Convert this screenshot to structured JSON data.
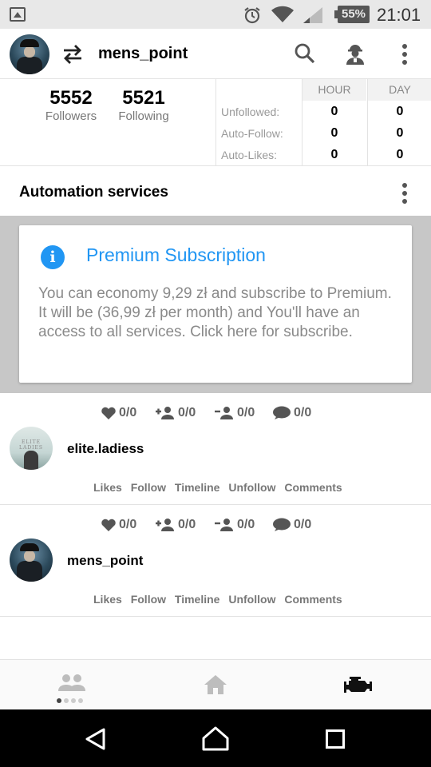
{
  "status_bar": {
    "battery": "55%",
    "time": "21:01"
  },
  "app_bar": {
    "username": "mens_point",
    "icons": [
      "swap-icon",
      "search-icon",
      "worker-icon",
      "more-vert-icon"
    ]
  },
  "stats": {
    "followers_count": "5552",
    "followers_label": "Followers",
    "following_count": "5521",
    "following_label": "Following",
    "columns": [
      "HOUR",
      "DAY"
    ],
    "rows": [
      {
        "label": "Unfollowed:",
        "hour": "0",
        "day": "0"
      },
      {
        "label": "Auto-Follow:",
        "hour": "0",
        "day": "0"
      },
      {
        "label": "Auto-Likes:",
        "hour": "0",
        "day": "0"
      }
    ]
  },
  "automation": {
    "title": "Automation services"
  },
  "premium": {
    "title": "Premium Subscription",
    "text": "You can economy 9,29 zł and subscribe to Premium. It will be (36,99 zł per month) and You'll have an access to all services. Click here for subscribe.",
    "accent": "#2196f3"
  },
  "accounts": [
    {
      "username": "elite.ladiess",
      "avatar_text": "ELITE LADIES",
      "likes": "0/0",
      "follow": "0/0",
      "unfollow": "0/0",
      "comments": "0/0",
      "actions": [
        "Likes",
        "Follow",
        "Timeline",
        "Unfollow",
        "Comments"
      ]
    },
    {
      "username": "mens_point",
      "likes": "0/0",
      "follow": "0/0",
      "unfollow": "0/0",
      "comments": "0/0",
      "actions": [
        "Likes",
        "Follow",
        "Timeline",
        "Unfollow",
        "Comments"
      ]
    }
  ],
  "bottom_nav": {
    "items": [
      "people-icon",
      "home-icon",
      "engine-icon"
    ],
    "page_dots": 4,
    "active_dot": 0
  },
  "system_nav": {
    "items": [
      "back-icon",
      "home-button-icon",
      "recent-apps-icon"
    ]
  }
}
